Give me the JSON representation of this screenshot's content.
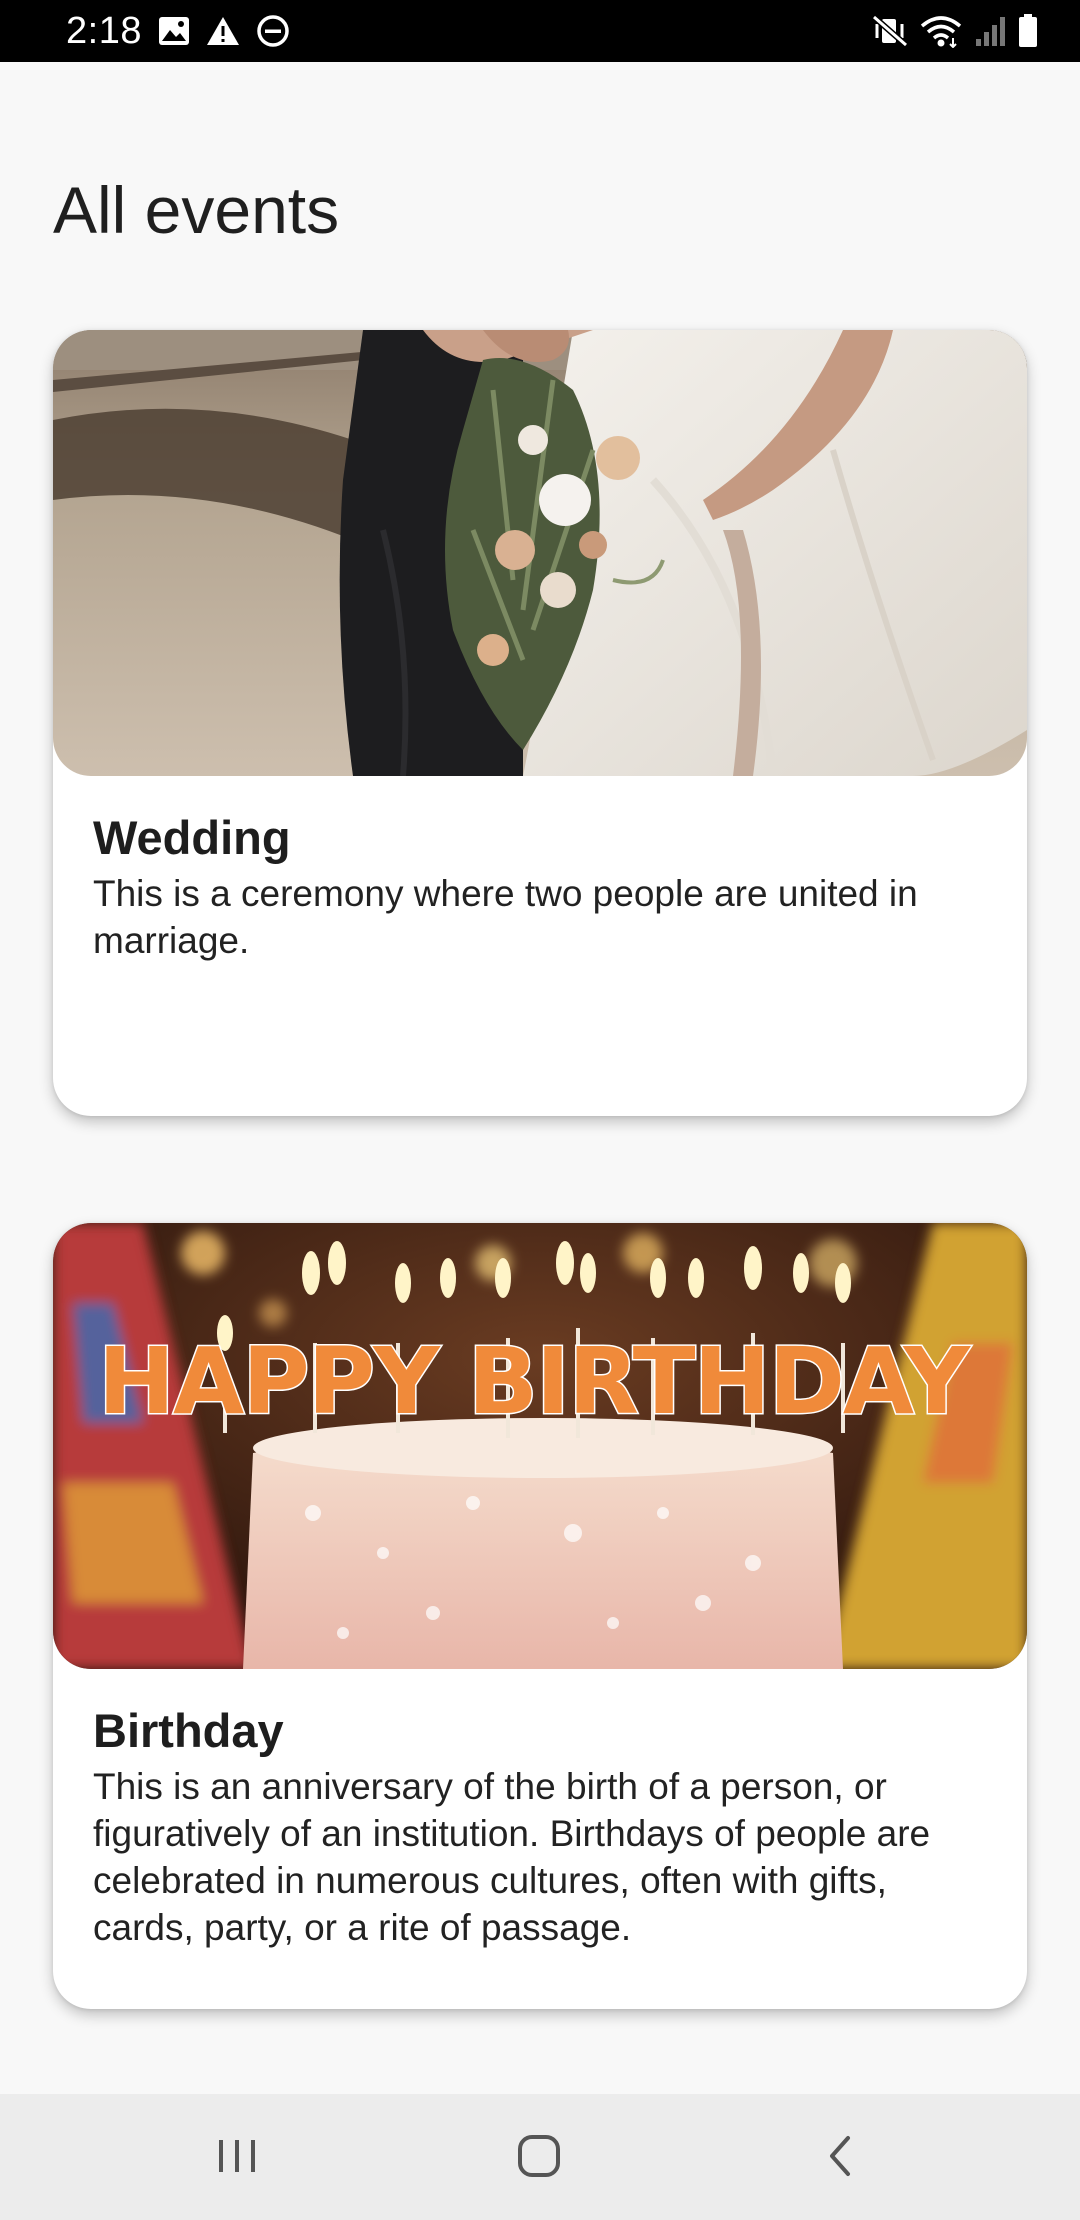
{
  "status_bar": {
    "time": "2:18",
    "left_icons": [
      "image-icon",
      "warning-icon",
      "do-not-disturb-icon"
    ],
    "right_icons": [
      "vibrate-mute-icon",
      "wifi-icon",
      "signal-icon",
      "battery-icon"
    ]
  },
  "page": {
    "title": "All events"
  },
  "events": [
    {
      "title": "Wedding",
      "description": "This is a ceremony where two people are united in marriage.",
      "image": "wedding-photo"
    },
    {
      "title": "Birthday",
      "description": "This is an anniversary of the birth of a person, or figuratively of an institution. Birthdays of people are celebrated in numerous cultures, often with gifts, cards, party, or a rite of passage.",
      "image": "birthday-cake-photo",
      "image_text": "HAPPY BIRTHDAY"
    }
  ],
  "nav_bar": {
    "buttons": [
      "recents-icon",
      "home-icon",
      "back-icon"
    ]
  },
  "colors": {
    "background": "#f8f8f8",
    "card": "#ffffff",
    "status_bar": "#000000",
    "nav_bar": "#ececec"
  }
}
